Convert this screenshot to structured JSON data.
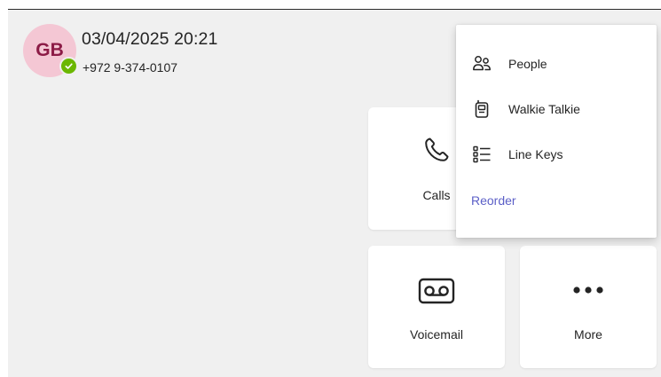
{
  "profile": {
    "initials": "GB",
    "datetime": "03/04/2025 20:21",
    "phone_number": "+972 9-374-0107",
    "presence_status_icon": "available-check-icon",
    "avatar_bg_color": "#f4c7d4",
    "avatar_text_color": "#8c1b46",
    "presence_color": "#6bb700"
  },
  "tiles": {
    "calls": {
      "label": "Calls",
      "icon": "phone-icon"
    },
    "voicemail": {
      "label": "Voicemail",
      "icon": "voicemail-icon"
    },
    "more": {
      "label": "More",
      "icon": "more-dots-icon"
    }
  },
  "menu": {
    "items": [
      {
        "label": "People",
        "icon": "people-icon"
      },
      {
        "label": "Walkie Talkie",
        "icon": "walkie-talkie-icon"
      },
      {
        "label": "Line Keys",
        "icon": "line-keys-icon"
      }
    ],
    "reorder_label": "Reorder",
    "accent_color": "#5b5fc7"
  }
}
